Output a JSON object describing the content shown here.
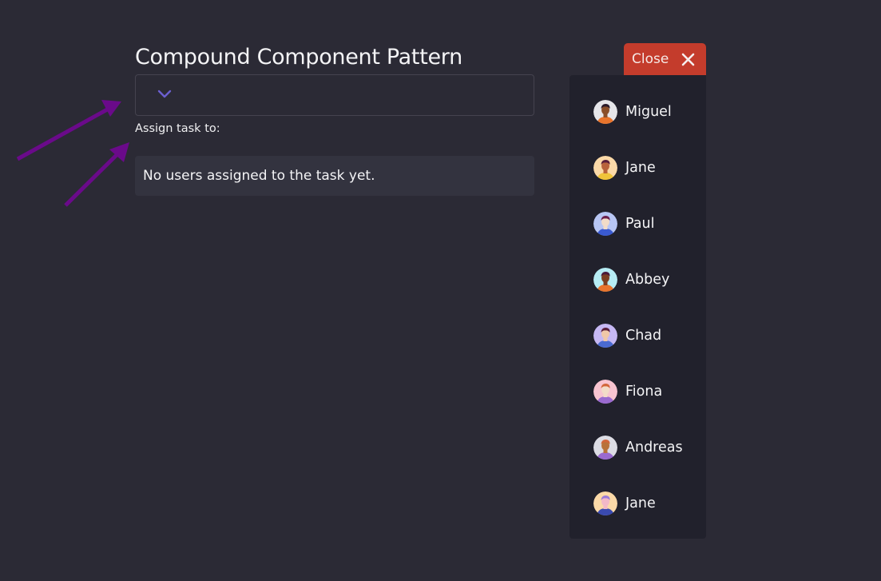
{
  "page": {
    "title": "Compound Component Pattern"
  },
  "select": {
    "icon": "chevron-down-icon",
    "chevron_color": "#6b5fd0"
  },
  "assign": {
    "label": "Assign task to:",
    "empty_message": "No users assigned to the task yet."
  },
  "close_button": {
    "label": "Close",
    "icon": "close-icon",
    "color": "#c43c2c"
  },
  "annotations": {
    "arrow_color": "#6a0a8a"
  },
  "users": [
    {
      "name": "Miguel",
      "avatar_bg": "#e6e6ea",
      "skin": "#8a4f2a",
      "hair": "#2a1a2a",
      "shirt": "#e8742c"
    },
    {
      "name": "Jane",
      "avatar_bg": "#fbd9a8",
      "skin": "#b8623a",
      "hair": "#5a1e3a",
      "shirt": "#f0c43a"
    },
    {
      "name": "Paul",
      "avatar_bg": "#b8c6f4",
      "skin": "#f2dcc8",
      "hair": "#6a1e4a",
      "shirt": "#3a5ad0"
    },
    {
      "name": "Abbey",
      "avatar_bg": "#b6ecf4",
      "skin": "#7a3e22",
      "hair": "#4a1a3a",
      "shirt": "#e8742c"
    },
    {
      "name": "Chad",
      "avatar_bg": "#c6b8f4",
      "skin": "#f0c8a8",
      "hair": "#5a1e3a",
      "shirt": "#4a6ad0"
    },
    {
      "name": "Fiona",
      "avatar_bg": "#f8c4d0",
      "skin": "#f2dcc8",
      "hair": "#d2663a",
      "shirt": "#9a6ad0"
    },
    {
      "name": "Andreas",
      "avatar_bg": "#dcdcE4",
      "skin": "#b8723a",
      "hair": "#d2663a",
      "shirt": "#9a6ad0"
    },
    {
      "name": "Jane",
      "avatar_bg": "#fbd9a8",
      "skin": "#f2b8c8",
      "hair": "#9a7ad8",
      "shirt": "#3a4ab0"
    }
  ]
}
